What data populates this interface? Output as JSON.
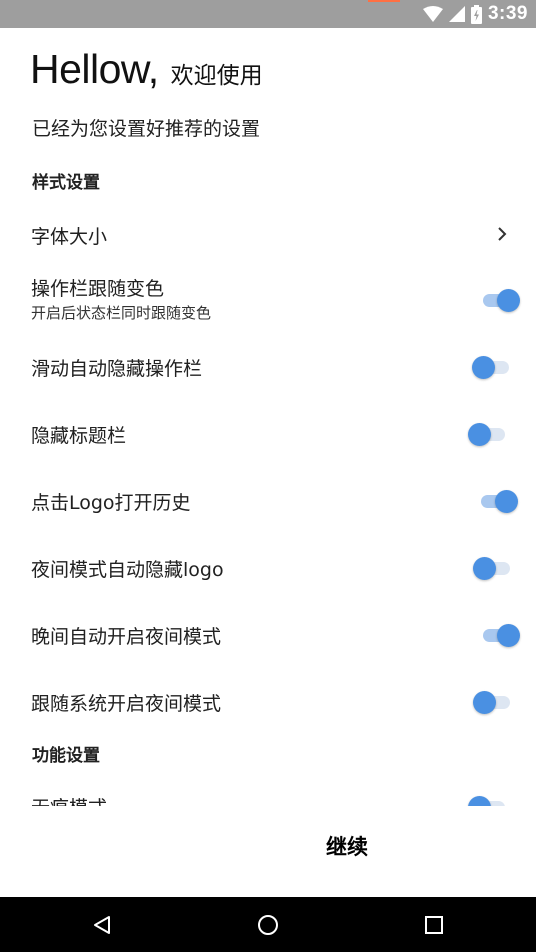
{
  "status_bar": {
    "time": "3:39",
    "icons": [
      "wifi-icon",
      "signal-icon",
      "battery-icon"
    ],
    "background": "#9e9e9e"
  },
  "header": {
    "greeting": "Hellow,",
    "welcome": "欢迎使用",
    "subtitle": "已经为您设置好推荐的设置"
  },
  "sections": {
    "style": "样式设置",
    "function": "功能设置"
  },
  "settings": [
    {
      "title": "字体大小",
      "type": "link",
      "icon": "chevron-right-icon"
    },
    {
      "title": "操作栏跟随变色",
      "summary": "开启后状态栏同时跟随变色",
      "type": "switch",
      "checked": true
    },
    {
      "title": "滑动自动隐藏操作栏",
      "type": "switch",
      "checked": false
    },
    {
      "title": "隐藏标题栏",
      "type": "switch",
      "checked": false
    },
    {
      "title": "点击Logo打开历史",
      "type": "switch",
      "checked": true
    },
    {
      "title": "夜间模式自动隐藏logo",
      "type": "switch",
      "checked": false
    },
    {
      "title": "晚间自动开启夜间模式",
      "type": "switch",
      "checked": true
    },
    {
      "title": "跟随系统开启夜间模式",
      "type": "switch",
      "checked": false
    },
    {
      "title": "无痕模式",
      "type": "switch",
      "checked": false
    }
  ],
  "actions": {
    "continue": "继续"
  },
  "nav_bar": {
    "buttons": [
      "back-icon",
      "home-icon",
      "recents-icon"
    ]
  },
  "colors": {
    "accent": "#4a90e2",
    "switch_track_on": "#a9c8ef",
    "switch_track_off": "#dde6f2"
  }
}
